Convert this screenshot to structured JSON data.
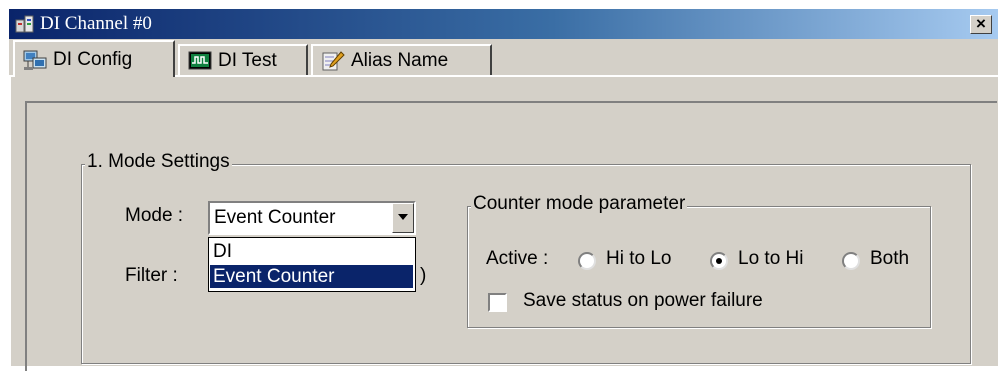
{
  "window": {
    "title": "DI Channel #0",
    "close_glyph": "×"
  },
  "tabs": [
    {
      "label": "DI Config",
      "icon": "network-config-icon",
      "active": true
    },
    {
      "label": "DI Test",
      "icon": "waveform-monitor-icon",
      "active": false
    },
    {
      "label": "Alias Name",
      "icon": "pencil-notepad-icon",
      "active": false
    }
  ],
  "mode_settings": {
    "title": "1. Mode Settings",
    "mode_label": "Mode :",
    "mode_value": "Event Counter",
    "filter_label": "Filter :",
    "filter_suffix": ")",
    "dropdown_options": [
      "DI",
      "Event Counter"
    ],
    "dropdown_selected": "Event Counter"
  },
  "counter_params": {
    "title": "Counter mode parameter",
    "active_label": "Active :",
    "options": [
      {
        "label": "Hi to Lo",
        "checked": false
      },
      {
        "label": "Lo to Hi",
        "checked": true
      },
      {
        "label": "Both",
        "checked": false
      }
    ],
    "save_status_label": "Save status on power failure",
    "save_status_checked": false
  }
}
